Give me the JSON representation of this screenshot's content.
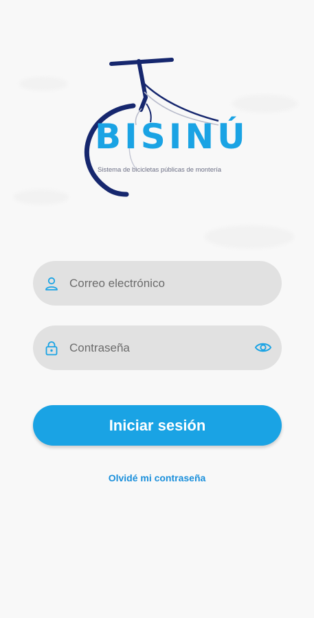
{
  "brand": {
    "name": "BISINÚ",
    "tagline": "Sistema de bicicletas públicas de montería"
  },
  "login_form": {
    "email_placeholder": "Correo electrónico",
    "password_placeholder": "Contraseña",
    "submit_label": "Iniciar sesión",
    "forgot_password_label": "Olvidé mi contraseña"
  },
  "icons": {
    "email": "user-icon",
    "password": "lock-icon",
    "toggle_visibility": "eye-icon"
  },
  "colors": {
    "accent": "#1aa3e4",
    "brand_navy": "#16276e",
    "field_bg": "#e1e1e1",
    "link": "#1a8fdb"
  }
}
